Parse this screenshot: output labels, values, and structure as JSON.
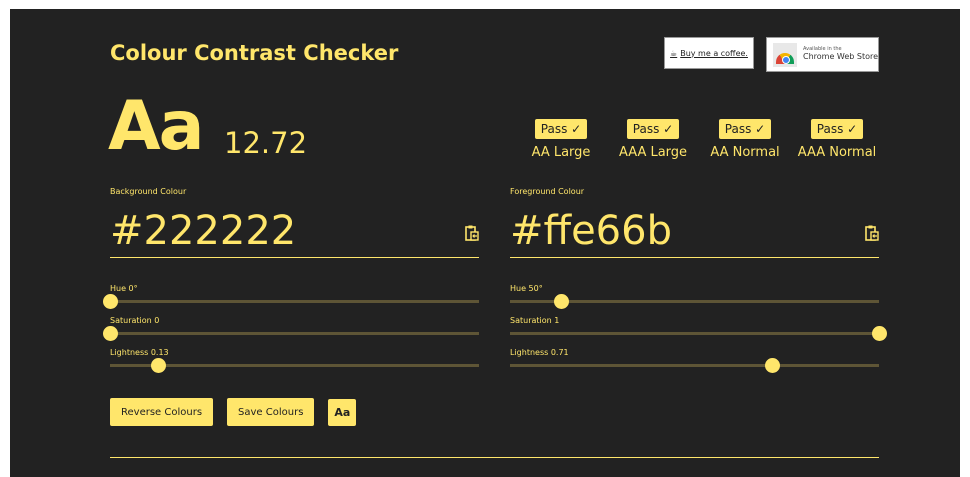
{
  "header": {
    "title": "Colour Contrast Checker",
    "coffee_label": "Buy me a coffee.",
    "coffee_icon": "coffee-cup-icon",
    "store_small": "Available in the",
    "store_big": "Chrome Web Store"
  },
  "preview": {
    "sample_text": "Aa",
    "ratio": "12.72"
  },
  "results": [
    {
      "status": "Pass ✓",
      "label": "AA Large"
    },
    {
      "status": "Pass ✓",
      "label": "AAA Large"
    },
    {
      "status": "Pass ✓",
      "label": "AA Normal"
    },
    {
      "status": "Pass ✓",
      "label": "AAA Normal"
    }
  ],
  "background": {
    "label": "Background Colour",
    "hex": "#222222",
    "paste_icon": "clipboard-paste-icon",
    "hue_label": "Hue 0°",
    "hue_value": 0,
    "saturation_label": "Saturation 0",
    "saturation_value": 0,
    "lightness_label": "Lightness 0.13",
    "lightness_value": 0.13
  },
  "foreground": {
    "label": "Foreground Colour",
    "hex": "#ffe66b",
    "paste_icon": "clipboard-paste-icon",
    "hue_label": "Hue 50°",
    "hue_value": 50,
    "saturation_label": "Saturation 1",
    "saturation_value": 1,
    "lightness_label": "Lightness 0.71",
    "lightness_value": 0.71
  },
  "actions": {
    "reverse_label": "Reverse Colours",
    "save_label": "Save Colours",
    "font_toggle_label": "Aa"
  },
  "colors": {
    "background": "#222222",
    "accent": "#ffe66b",
    "track": "#5e5536"
  }
}
